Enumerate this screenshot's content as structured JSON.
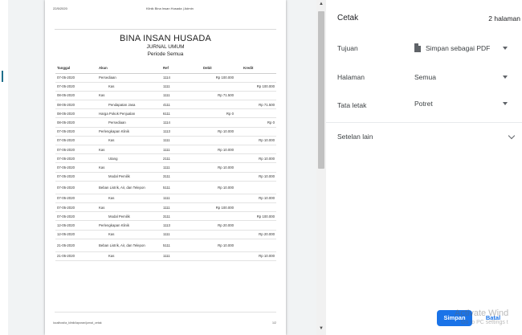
{
  "preview": {
    "header_date": "22/5/2020",
    "header_title": "Klinik Bina Insan Husada | Admin",
    "company": "BINA INSAN HUSADA",
    "subtitle": "JURNAL UMUM",
    "period": "Periode Semua",
    "columns": [
      "Tanggal",
      "Akun",
      "Ref",
      "Debit",
      "Kredit"
    ],
    "rows": [
      {
        "date": "07-05-2020",
        "account": "Persediaan",
        "ref": "1114",
        "debit": "Rp 100.000",
        "credit": "",
        "indent": false
      },
      {
        "date": "07-05-2020",
        "account": "Kas",
        "ref": "1111",
        "debit": "",
        "credit": "Rp 100.000",
        "indent": true
      },
      {
        "date": "08-05-2020",
        "account": "Kas",
        "ref": "1111",
        "debit": "Rp 71.500",
        "credit": "",
        "indent": false
      },
      {
        "date": "08-05-2020",
        "account": "Pendapatan Jasa",
        "ref": "4111",
        "debit": "",
        "credit": "Rp 71.500",
        "indent": true
      },
      {
        "date": "08-05-2020",
        "account": "Harga Pokok Penjualan",
        "ref": "6111",
        "debit": "Rp 0",
        "credit": "",
        "indent": false
      },
      {
        "date": "08-05-2020",
        "account": "Persediaan",
        "ref": "1114",
        "debit": "",
        "credit": "Rp 0",
        "indent": true
      },
      {
        "date": "07-05-2020",
        "account": "Perlengkapan Klinik",
        "ref": "1113",
        "debit": "Rp 10.000",
        "credit": "",
        "indent": false
      },
      {
        "date": "07-05-2020",
        "account": "Kas",
        "ref": "1111",
        "debit": "",
        "credit": "Rp 10.000",
        "indent": true
      },
      {
        "date": "07-05-2020",
        "account": "Kas",
        "ref": "1111",
        "debit": "Rp 10.000",
        "credit": "",
        "indent": false
      },
      {
        "date": "07-05-2020",
        "account": "Utang",
        "ref": "2111",
        "debit": "",
        "credit": "Rp 10.000",
        "indent": true
      },
      {
        "date": "07-05-2020",
        "account": "Kas",
        "ref": "1111",
        "debit": "Rp 10.000",
        "credit": "",
        "indent": false
      },
      {
        "date": "07-05-2020",
        "account": "Modal Pemilik",
        "ref": "3111",
        "debit": "",
        "credit": "Rp 10.000",
        "indent": true
      },
      {
        "date": "07-05-2020",
        "account": "Beban Listrik, Air, dan Telepon",
        "ref": "5111",
        "debit": "Rp 10.000",
        "credit": "",
        "indent": false,
        "tall": true
      },
      {
        "date": "07-05-2020",
        "account": "Kas",
        "ref": "1111",
        "debit": "",
        "credit": "Rp 10.000",
        "indent": true
      },
      {
        "date": "07-05-2020",
        "account": "Kas",
        "ref": "1111",
        "debit": "Rp 100.000",
        "credit": "",
        "indent": false
      },
      {
        "date": "07-05-2020",
        "account": "Modal Pemilik",
        "ref": "3111",
        "debit": "",
        "credit": "Rp 100.000",
        "indent": true
      },
      {
        "date": "12-05-2020",
        "account": "Perlengkapan Klinik",
        "ref": "1113",
        "debit": "Rp 20.000",
        "credit": "",
        "indent": false
      },
      {
        "date": "12-05-2020",
        "account": "Kas",
        "ref": "1111",
        "debit": "",
        "credit": "Rp 20.000",
        "indent": true
      },
      {
        "date": "21-05-2020",
        "account": "Beban Listrik, Air, dan Telepon",
        "ref": "5111",
        "debit": "Rp 10.000",
        "credit": "",
        "indent": false,
        "tall": true
      },
      {
        "date": "21-05-2020",
        "account": "Kas",
        "ref": "1111",
        "debit": "",
        "credit": "Rp 10.000",
        "indent": true
      }
    ],
    "footer_url": "localhost/a_klinik/laporan/jurnal_cetak",
    "footer_page": "1/2"
  },
  "panel": {
    "title": "Cetak",
    "pages": "2 halaman",
    "destination_label": "Tujuan",
    "destination_value": "Simpan sebagai PDF",
    "pages_label": "Halaman",
    "pages_value": "Semua",
    "layout_label": "Tata letak",
    "layout_value": "Potret",
    "more_settings": "Setelan lain",
    "save_button": "Simpan",
    "cancel_button": "Batal"
  },
  "watermark": {
    "line1": "Activate Wind",
    "line2": "Go to PC settings t"
  },
  "colors": {
    "accent": "#1a73e8",
    "preview_bg": "#f1f3f4"
  }
}
